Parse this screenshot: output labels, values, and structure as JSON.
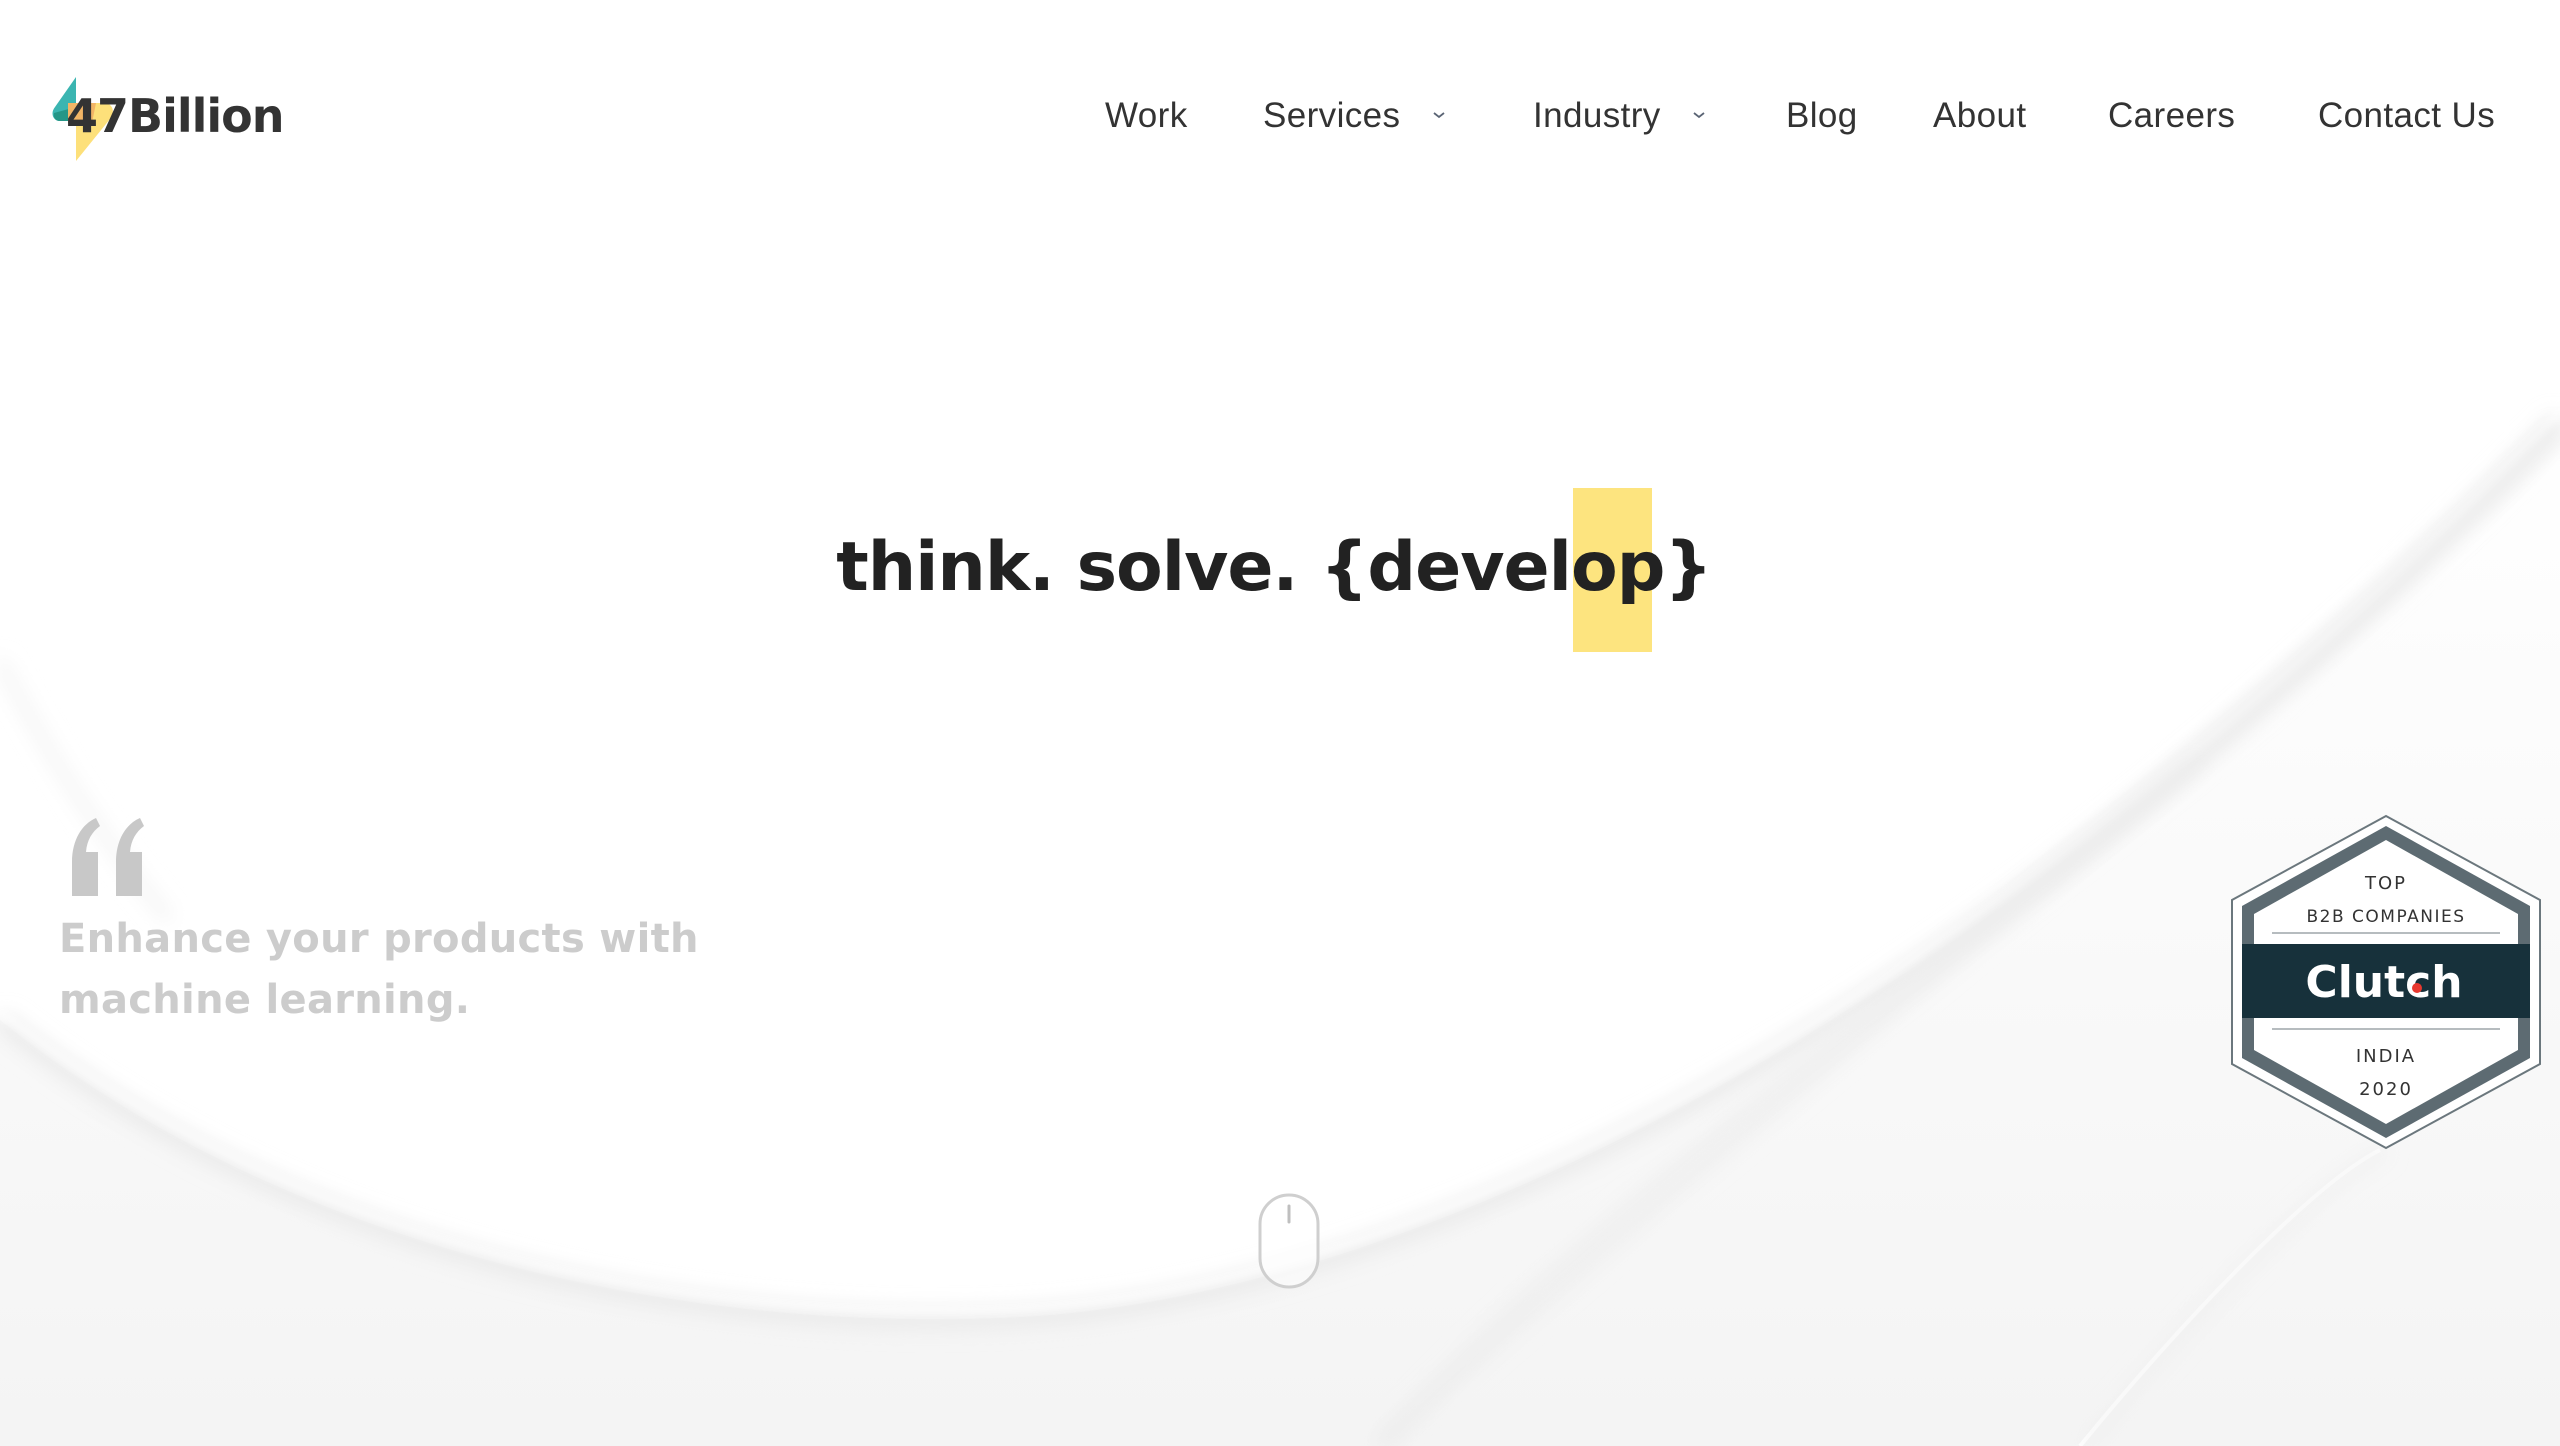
{
  "brand": {
    "name": "47Billion",
    "logo_icon": "lightning-bolt-logo-icon",
    "colors": {
      "teal": "#3bb5b1",
      "dark_teal": "#259687",
      "orange": "#f2b566",
      "yellow": "#fde07a",
      "text": "#333333"
    }
  },
  "nav": {
    "items": [
      {
        "label": "Work",
        "has_dropdown": false
      },
      {
        "label": "Services",
        "has_dropdown": true,
        "icon": "chevron-down-icon"
      },
      {
        "label": "Industry",
        "has_dropdown": true,
        "icon": "chevron-down-icon"
      },
      {
        "label": "Blog",
        "has_dropdown": false
      },
      {
        "label": "About",
        "has_dropdown": false
      },
      {
        "label": "Careers",
        "has_dropdown": false
      },
      {
        "label": "Contact Us",
        "has_dropdown": false
      }
    ]
  },
  "hero": {
    "headline": "think. solve. {develop}",
    "highlight_color": "#fde47f",
    "text_color": "#222222"
  },
  "quote": {
    "icon": "quote-icon",
    "text": "Enhance your products with machine learning.",
    "text_color": "#cccccc"
  },
  "badge": {
    "top_line": "TOP",
    "category": "B2B COMPANIES",
    "brand": "Clutch",
    "region": "INDIA",
    "year": "2020",
    "colors": {
      "dark": "#17313b",
      "frame": "#5d6b72",
      "dot": "#e8382f"
    }
  },
  "scroll_indicator": {
    "icon": "mouse-scroll-icon"
  }
}
